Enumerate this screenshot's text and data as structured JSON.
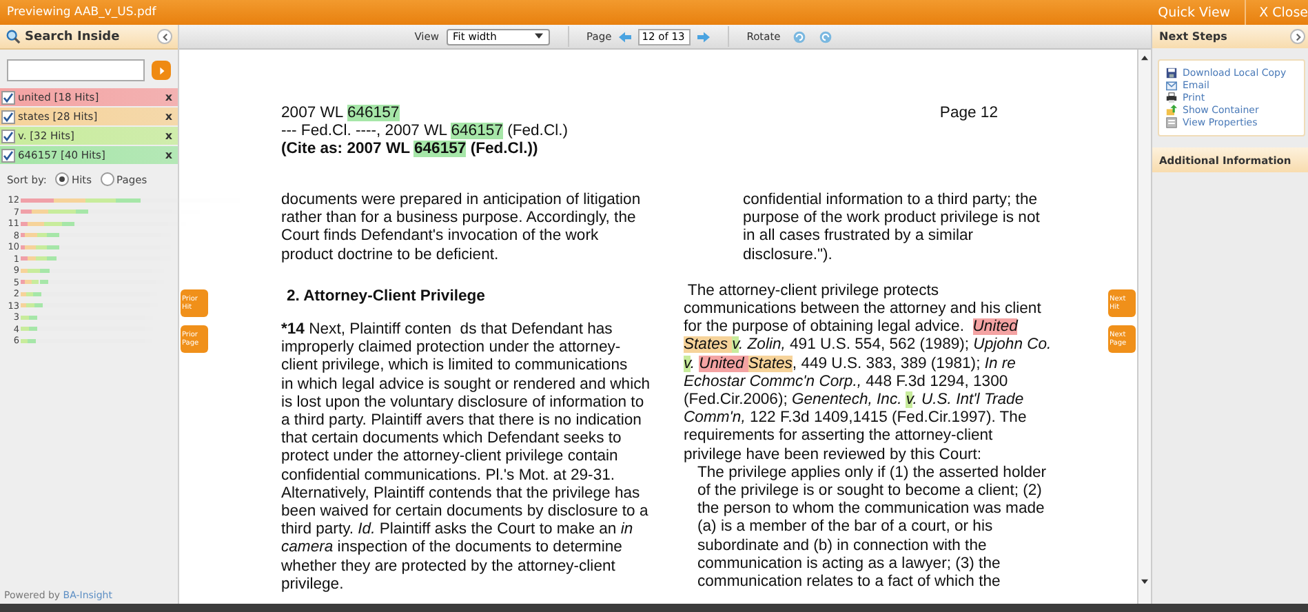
{
  "window": {
    "title": "Previewing AAB_v_US.pdf",
    "actions": [
      "Quick View",
      "X Close"
    ]
  },
  "search_panel": {
    "title": "Search Inside",
    "terms": [
      {
        "label": "united [18 Hits]",
        "checked": true,
        "color": "#f4a3a3",
        "remove": "x"
      },
      {
        "label": "states [28 Hits]",
        "checked": true,
        "color": "#f6d39a",
        "remove": "x"
      },
      {
        "label": "v. [32 Hits]",
        "checked": true,
        "color": "#c8ec9c",
        "remove": "x"
      },
      {
        "label": "646157 [40 Hits]",
        "checked": true,
        "color": "#a6e6a8",
        "remove": "x"
      }
    ],
    "sort_label": "Sort by:",
    "sort_options": [
      {
        "label": "Hits",
        "selected": true
      },
      {
        "label": "Pages",
        "selected": false
      }
    ],
    "pages": [
      {
        "page": "12",
        "segments": [
          {
            "color": "#f0a0a8",
            "level": 0.27
          },
          {
            "color": "#f6d39a",
            "level": 0.25
          },
          {
            "color": "#c8ec9c",
            "level": 0.25
          },
          {
            "color": "#a6e6a8",
            "level": 0.2
          }
        ]
      },
      {
        "page": "7",
        "segments": [
          {
            "color": "#f0a0a8",
            "level": 0.09
          },
          {
            "color": "#f6d39a",
            "level": 0.13
          },
          {
            "color": "#c8ec9c",
            "level": 0.22
          },
          {
            "color": "#a6e6a8",
            "level": 0.1
          }
        ]
      },
      {
        "page": "11",
        "segments": [
          {
            "color": "#f0a0a8",
            "level": 0.06
          },
          {
            "color": "#f6d39a",
            "level": 0.13
          },
          {
            "color": "#c8ec9c",
            "level": 0.14
          },
          {
            "color": "#a6e6a8",
            "level": 0.1
          }
        ]
      },
      {
        "page": "8",
        "segments": [
          {
            "color": "#f0a0a8",
            "level": 0.03
          },
          {
            "color": "#f6d39a",
            "level": 0.1
          },
          {
            "color": "#c8ec9c",
            "level": 0.08
          },
          {
            "color": "#a6e6a8",
            "level": 0.1
          }
        ]
      },
      {
        "page": "10",
        "segments": [
          {
            "color": "#f0a0a8",
            "level": 0.03
          },
          {
            "color": "#f6d39a",
            "level": 0.09
          },
          {
            "color": "#c8ec9c",
            "level": 0.09
          },
          {
            "color": "#a6e6a8",
            "level": 0.1
          }
        ]
      },
      {
        "page": "1",
        "segments": [
          {
            "color": "#f0a0a8",
            "level": 0.06
          },
          {
            "color": "#f6d39a",
            "level": 0.06
          },
          {
            "color": "#c8ec9c",
            "level": 0.09
          },
          {
            "color": "#a6e6a8",
            "level": 0.08
          }
        ]
      },
      {
        "page": "9",
        "segments": [
          {
            "color": "#f6d39a",
            "level": 0.05
          },
          {
            "color": "#c8ec9c",
            "level": 0.1
          },
          {
            "color": "#a6e6a8",
            "level": 0.08
          }
        ]
      },
      {
        "page": "5",
        "segments": [
          {
            "color": "#f0a0a8",
            "level": 0.03
          },
          {
            "color": "#f6d39a",
            "level": 0.06
          },
          {
            "color": "#c8ec9c",
            "level": 0.06
          },
          {
            "color": "#a6e6a8",
            "level": 0.07
          }
        ]
      },
      {
        "page": "2",
        "segments": [
          {
            "color": "#f6d39a",
            "level": 0.04
          },
          {
            "color": "#c8ec9c",
            "level": 0.06
          },
          {
            "color": "#a6e6a8",
            "level": 0.07
          }
        ]
      },
      {
        "page": "13",
        "segments": [
          {
            "color": "#f6d39a",
            "level": 0.04
          },
          {
            "color": "#c8ec9c",
            "level": 0.07
          },
          {
            "color": "#a6e6a8",
            "level": 0.07
          }
        ]
      },
      {
        "page": "3",
        "segments": [
          {
            "color": "#c8ec9c",
            "level": 0.07
          },
          {
            "color": "#a6e6a8",
            "level": 0.06
          }
        ]
      },
      {
        "page": "4",
        "segments": [
          {
            "color": "#c8ec9c",
            "level": 0.07
          },
          {
            "color": "#a6e6a8",
            "level": 0.06
          }
        ]
      },
      {
        "page": "6",
        "segments": [
          {
            "color": "#c8ec9c",
            "level": 0.06
          },
          {
            "color": "#a6e6a8",
            "level": 0.06
          }
        ]
      }
    ],
    "footer_prefix": "Powered by",
    "footer_link": "BA-Insight"
  },
  "toolbar": {
    "view_label": "View",
    "view_value": "Fit width",
    "page_label": "Page",
    "page_value": "12 of 13",
    "rotate_label": "Rotate"
  },
  "nav_buttons": {
    "prior_hit": "Prior Hit",
    "prior_page": "Prior Page",
    "next_hit": "Next Hit",
    "next_page": "Next Page"
  },
  "document": {
    "page_label": "Page 12",
    "header": [
      {
        "kind": "plain",
        "segments": [
          {
            "text": "2007 WL "
          },
          {
            "text": "646157",
            "color": "#a6e6a8"
          }
        ]
      },
      {
        "kind": "plain",
        "segments": [
          {
            "text": "--- Fed.Cl. ----, 2007 WL "
          },
          {
            "text": "646157",
            "color": "#a6e6a8"
          },
          {
            "text": " (Fed.Cl.)"
          }
        ]
      },
      {
        "kind": "bold",
        "segments": [
          {
            "text": "(Cite as: 2007 WL "
          },
          {
            "text": "646157",
            "color": "#a6e6a8"
          },
          {
            "text": " (Fed.Cl.))"
          }
        ]
      }
    ],
    "left_column": [
      {
        "kind": "paragraph",
        "segments": [
          {
            "text": "documents were prepared in anticipation of litigation\nrather than for a business purpose. Accordingly, the\nCourt finds Defendant's invocation of the work\nproduct doctrine to be deficient."
          }
        ]
      },
      {
        "kind": "heading",
        "segments": [
          {
            "text": "2. Attorney-Client Privilege"
          }
        ]
      },
      {
        "kind": "paragraph",
        "segments": [
          {
            "text": "*14",
            "bold": true
          },
          {
            "text": " Next, Plaintiff conten  ds that Defendant has\nimproperly claimed protection under the attorney-\nclient privilege, which is limited to communications\nin which legal advice is sought or rendered and which\nis lost upon the voluntary disclosure of information to\na third party. Plaintiff avers that there is no indication\nthat certain documents which Defendant seeks to\nprotect under the attorney-client privilege contain\nconfidential communications. Pl.'s Mot. at 29-31.\nAlternatively, Plaintiff contends that the privilege has\nbeen waived for certain documents by disclosure to a\nthird party. "
          },
          {
            "text": "Id.",
            "italic": true
          },
          {
            "text": " Plaintiff asks the Court to make an "
          },
          {
            "text": "in\ncamera",
            "italic": true
          },
          {
            "text": " inspection of the documents to determine\nwhether they are protected by the attorney-client\nprivilege."
          }
        ]
      }
    ],
    "right_column": [
      {
        "kind": "indented",
        "segments": [
          {
            "text": "confidential information to a third party; the\npurpose of the work product privilege is not\nin all cases frustrated by a similar\ndisclosure.\")."
          }
        ]
      },
      {
        "kind": "paragraph",
        "segments": [
          {
            "text": " The attorney-client privilege protects\ncommunications between the attorney and his client\nfor the purpose of obtaining legal advice.  "
          },
          {
            "text": "United",
            "italic": true,
            "color": "#f4a3a3"
          },
          {
            "text": "\nStates ",
            "italic": true,
            "color": "#f6d39a"
          },
          {
            "text": "v",
            "italic": true,
            "color": "#c8ec9c"
          },
          {
            "text": ". Zolin,",
            "italic": true
          },
          {
            "text": " 491 U.S. 554, 562 (1989); "
          },
          {
            "text": "Upjohn Co.",
            "italic": true
          },
          {
            "text": "\nv",
            "italic": true,
            "color": "#c8ec9c"
          },
          {
            "text": ". ",
            "italic": true
          },
          {
            "text": "United ",
            "italic": true,
            "color": "#f4a3a3"
          },
          {
            "text": "States",
            "italic": true,
            "color": "#f6d39a"
          },
          {
            "text": ", 449 U.S. 383, 389 (1981); "
          },
          {
            "text": "In re\nEchostar Commc'n Corp.,",
            "italic": true
          },
          {
            "text": " 448 F.3d 1294, 1300\n(Fed.Cir.2006); "
          },
          {
            "text": "Genentech, Inc. ",
            "italic": true
          },
          {
            "text": "v",
            "italic": true,
            "color": "#c8ec9c"
          },
          {
            "text": ". U.S. Int'l Trade\nComm'n,",
            "italic": true
          },
          {
            "text": " 122 F.3d 1409,1415 (Fed.Cir.1997). The\nrequirements for asserting the attorney-client\nprivilege have been reviewed by this Court:"
          }
        ]
      },
      {
        "kind": "quote",
        "segments": [
          {
            "text": "The privilege applies only if (1) the asserted holder\nof the privilege is or sought to become a client; (2)\nthe person to whom the communication was made\n(a) is a member of the bar of a court, or his\nsubordinate and (b) in connection with the\ncommunication is acting as a lawyer; (3) the\ncommunication relates to a fact of which the"
          }
        ]
      }
    ]
  },
  "next_steps": {
    "title": "Next Steps",
    "items": [
      {
        "kind": "download",
        "label": "Download Local Copy"
      },
      {
        "kind": "email",
        "label": "Email"
      },
      {
        "kind": "print",
        "label": "Print"
      },
      {
        "kind": "container",
        "label": "Show Container"
      },
      {
        "kind": "properties",
        "label": "View Properties"
      }
    ],
    "section": "Additional Information"
  }
}
